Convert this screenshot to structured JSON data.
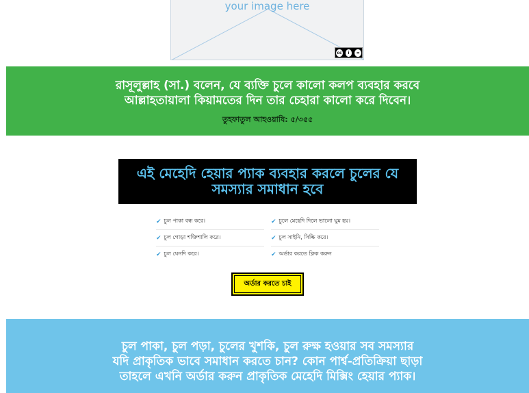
{
  "placeholder": {
    "text": "your image here"
  },
  "quote_section": {
    "line1": "রাসূলুল্লাহ (সা.) বলেন, যে ব্যক্তি চুলে কালো কলপ ব্যবহার করবে",
    "line2": "আল্লাহতায়ালা কিয়ামতের দিন তার চেহারা কালো করে দিবেন।",
    "reference": "তুহফাতুল আহওয়াযি: ৫/৩৫৫",
    "bg_color": "#41b249"
  },
  "benefits": {
    "title_line1": "এই মেহেদি হেয়ার প্যাক ব্যবহার করলে চুলের যে",
    "title_line2": "সমস্যার সমাধান হবে",
    "items": [
      "চুল পাকা বন্ধ করে।",
      "চুলে মেহেদি দিলে ভালো ঘুম হয়।",
      "চুল গোড়া শক্তিশালি করে।",
      "চুল সাইনি, সিল্কি করে।",
      "চুল ঘেনদি করে।",
      "অর্ডার করতে ক্লিক করুন"
    ],
    "accent": "#3b9ed8"
  },
  "order_button": {
    "label": "অর্ডার করতে চাই",
    "color": "#fff200"
  },
  "promo": {
    "line1": "চুল পাকা, চুল পড়া, চুলের খুশকি, চুল রুক্ষ হওয়ার সব সমস্যার",
    "line2": "যদি প্রাকৃতিক ভাবে সমাধান করতে চান? কোন পার্শ্ব-প্রতিক্রিয়া ছাড়া",
    "line3": "তাহলে এখনি অর্ডার করুন প্রাকৃতিক মেহেদি মিক্সিং হেয়ার প্যাক।",
    "bg_color": "#6fc4ea"
  }
}
